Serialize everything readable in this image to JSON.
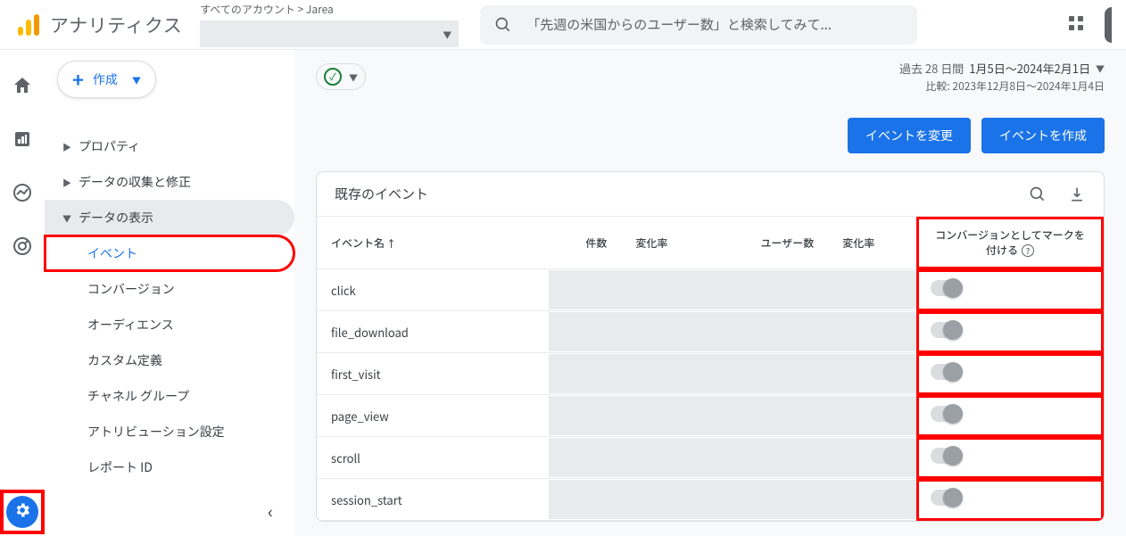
{
  "header": {
    "product": "アナリティクス",
    "breadcrumb": "すべてのアカウント > Jarea",
    "search_placeholder": "「先週の米国からのユーザー数」と検索してみて..."
  },
  "create_button": {
    "label": "作成"
  },
  "nav": {
    "items": [
      {
        "label": "プロパティ",
        "expandable": true,
        "open": false
      },
      {
        "label": "データの収集と修正",
        "expandable": true,
        "open": false
      },
      {
        "label": "データの表示",
        "expandable": true,
        "open": true,
        "active": true
      }
    ],
    "sub_items": [
      {
        "label": "イベント",
        "selected": true,
        "highlight": true
      },
      {
        "label": "コンバージョン"
      },
      {
        "label": "オーディエンス"
      },
      {
        "label": "カスタム定義"
      },
      {
        "label": "チャネル グループ"
      },
      {
        "label": "アトリビューション設定"
      },
      {
        "label": "レポート ID"
      }
    ]
  },
  "date": {
    "range_label": "過去 28 日間",
    "range": "1月5日～2024年2月1日",
    "compare": "比較: 2023年12月8日～2024年1月4日"
  },
  "actions": {
    "modify": "イベントを変更",
    "create": "イベントを作成"
  },
  "table": {
    "title": "既存のイベント",
    "columns": {
      "name": "イベント名",
      "count": "件数",
      "count_change": "変化率",
      "users": "ユーザー数",
      "users_change": "変化率",
      "conversion_mark": "コンバージョンとしてマークを付ける"
    },
    "rows": [
      {
        "name": "click"
      },
      {
        "name": "file_download"
      },
      {
        "name": "first_visit"
      },
      {
        "name": "page_view"
      },
      {
        "name": "scroll"
      },
      {
        "name": "session_start"
      }
    ]
  }
}
